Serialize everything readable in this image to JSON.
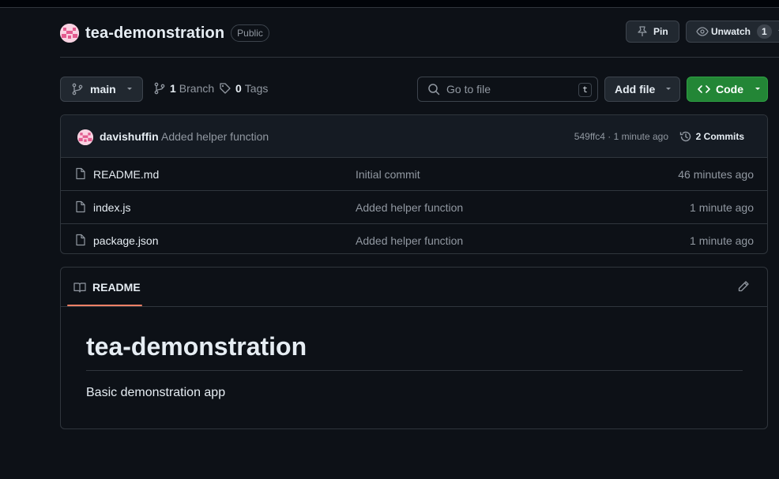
{
  "repo": {
    "name": "tea-demonstration",
    "visibility": "Public",
    "pin_label": "Pin",
    "watch_label": "Unwatch",
    "watch_count": "1"
  },
  "toolbar": {
    "branch": "main",
    "branch_count": "1",
    "branch_label": "Branch",
    "tag_count": "0",
    "tag_label": "Tags",
    "search_placeholder": "Go to file",
    "search_shortcut": "t",
    "add_file_label": "Add file",
    "code_label": "Code"
  },
  "latest_commit": {
    "author": "davishuffin",
    "message": "Added helper function",
    "meta": "549ffc4 · 1 minute ago",
    "commits_label": "2 Commits"
  },
  "files": [
    {
      "name": "README.md",
      "message": "Initial commit",
      "time": "46 minutes ago"
    },
    {
      "name": "index.js",
      "message": "Added helper function",
      "time": "1 minute ago"
    },
    {
      "name": "package.json",
      "message": "Added helper function",
      "time": "1 minute ago"
    }
  ],
  "readme": {
    "tab_label": "README",
    "title": "tea-demonstration",
    "body": "Basic demonstration app"
  },
  "colors": {
    "background": "#0d1117",
    "accent_green": "#238636",
    "tab_underline": "#f78166"
  },
  "icons": [
    "avatar-identicon",
    "pin-icon",
    "eye-icon",
    "branch-icon",
    "tag-icon",
    "search-icon",
    "caret-down-icon",
    "code-icon",
    "history-icon",
    "file-icon",
    "book-icon",
    "pencil-icon"
  ]
}
